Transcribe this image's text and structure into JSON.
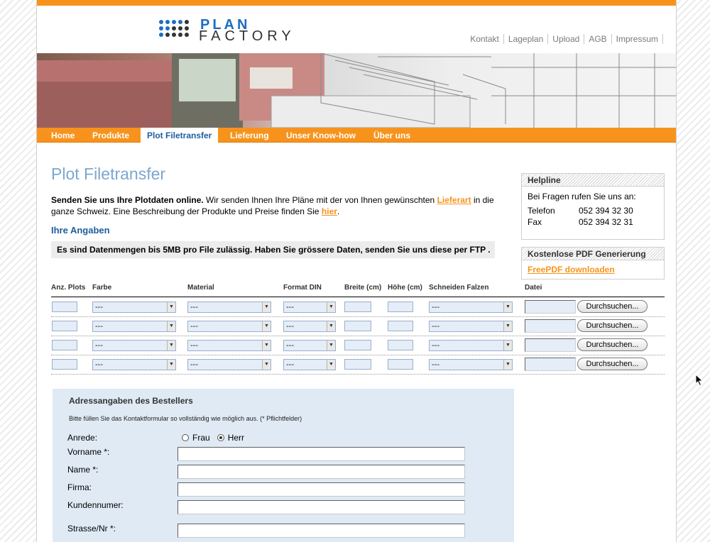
{
  "logo": {
    "line1": "PLAN",
    "line2": "FACTORY"
  },
  "top_nav": [
    "Kontakt",
    "Lageplan",
    "Upload",
    "AGB",
    "Impressum"
  ],
  "main_nav": {
    "items": [
      "Home",
      "Produkte",
      "Plot Filetransfer",
      "Lieferung",
      "Unser Know-how",
      "Über uns"
    ],
    "active": "Plot Filetransfer"
  },
  "page": {
    "title": "Plot Filetransfer",
    "intro_bold": "Senden Sie uns Ihre Plotdaten online.",
    "intro_text1": " Wir senden Ihnen Ihre Pläne mit der von Ihnen gewünschten ",
    "intro_link1": "Lieferart",
    "intro_text2": " in die ganze Schweiz. Eine Beschreibung der Produkte und Preise finden Sie ",
    "intro_link2": "hier",
    "intro_text3": ".",
    "section_title": "Ihre Angaben",
    "notice": "Es sind Datenmengen bis 5MB pro File zulässig. Haben Sie grössere Daten, senden Sie uns diese per FTP ."
  },
  "sidebar": {
    "helpline": {
      "title": "Helpline",
      "intro": "Bei Fragen rufen Sie uns an:",
      "phone_label": "Telefon",
      "phone": "052 394 32 30",
      "fax_label": "Fax",
      "fax": "052 394 32 31"
    },
    "pdf": {
      "title": "Kostenlose PDF Generierung",
      "link": "FreePDF downloaden"
    }
  },
  "upload_table": {
    "headers": [
      "Anz. Plots",
      "Farbe",
      "Material",
      "Format DIN",
      "Breite (cm)",
      "Höhe (cm)",
      "Schneiden Falzen",
      "Datei"
    ],
    "select_placeholder": "---",
    "browse_label": "Durchsuchen...",
    "rows": 4
  },
  "address": {
    "title": "Adressangaben des Bestellers",
    "note": "Bitte füllen Sie das Kontaktformular so vollständig wie möglich aus. (* Pflichtfelder)",
    "anrede_label": "Anrede:",
    "anrede_options": [
      "Frau",
      "Herr"
    ],
    "anrede_selected": "Herr",
    "fields": [
      "Vorname *:",
      "Name *:",
      "Firma:",
      "Kundennumer:",
      "Strasse/Nr *:"
    ]
  },
  "colors": {
    "accent": "#f7931d",
    "heading_blue": "#1b5e9e",
    "title_blue": "#7ba7cf",
    "form_bg": "#dfeaf5"
  }
}
